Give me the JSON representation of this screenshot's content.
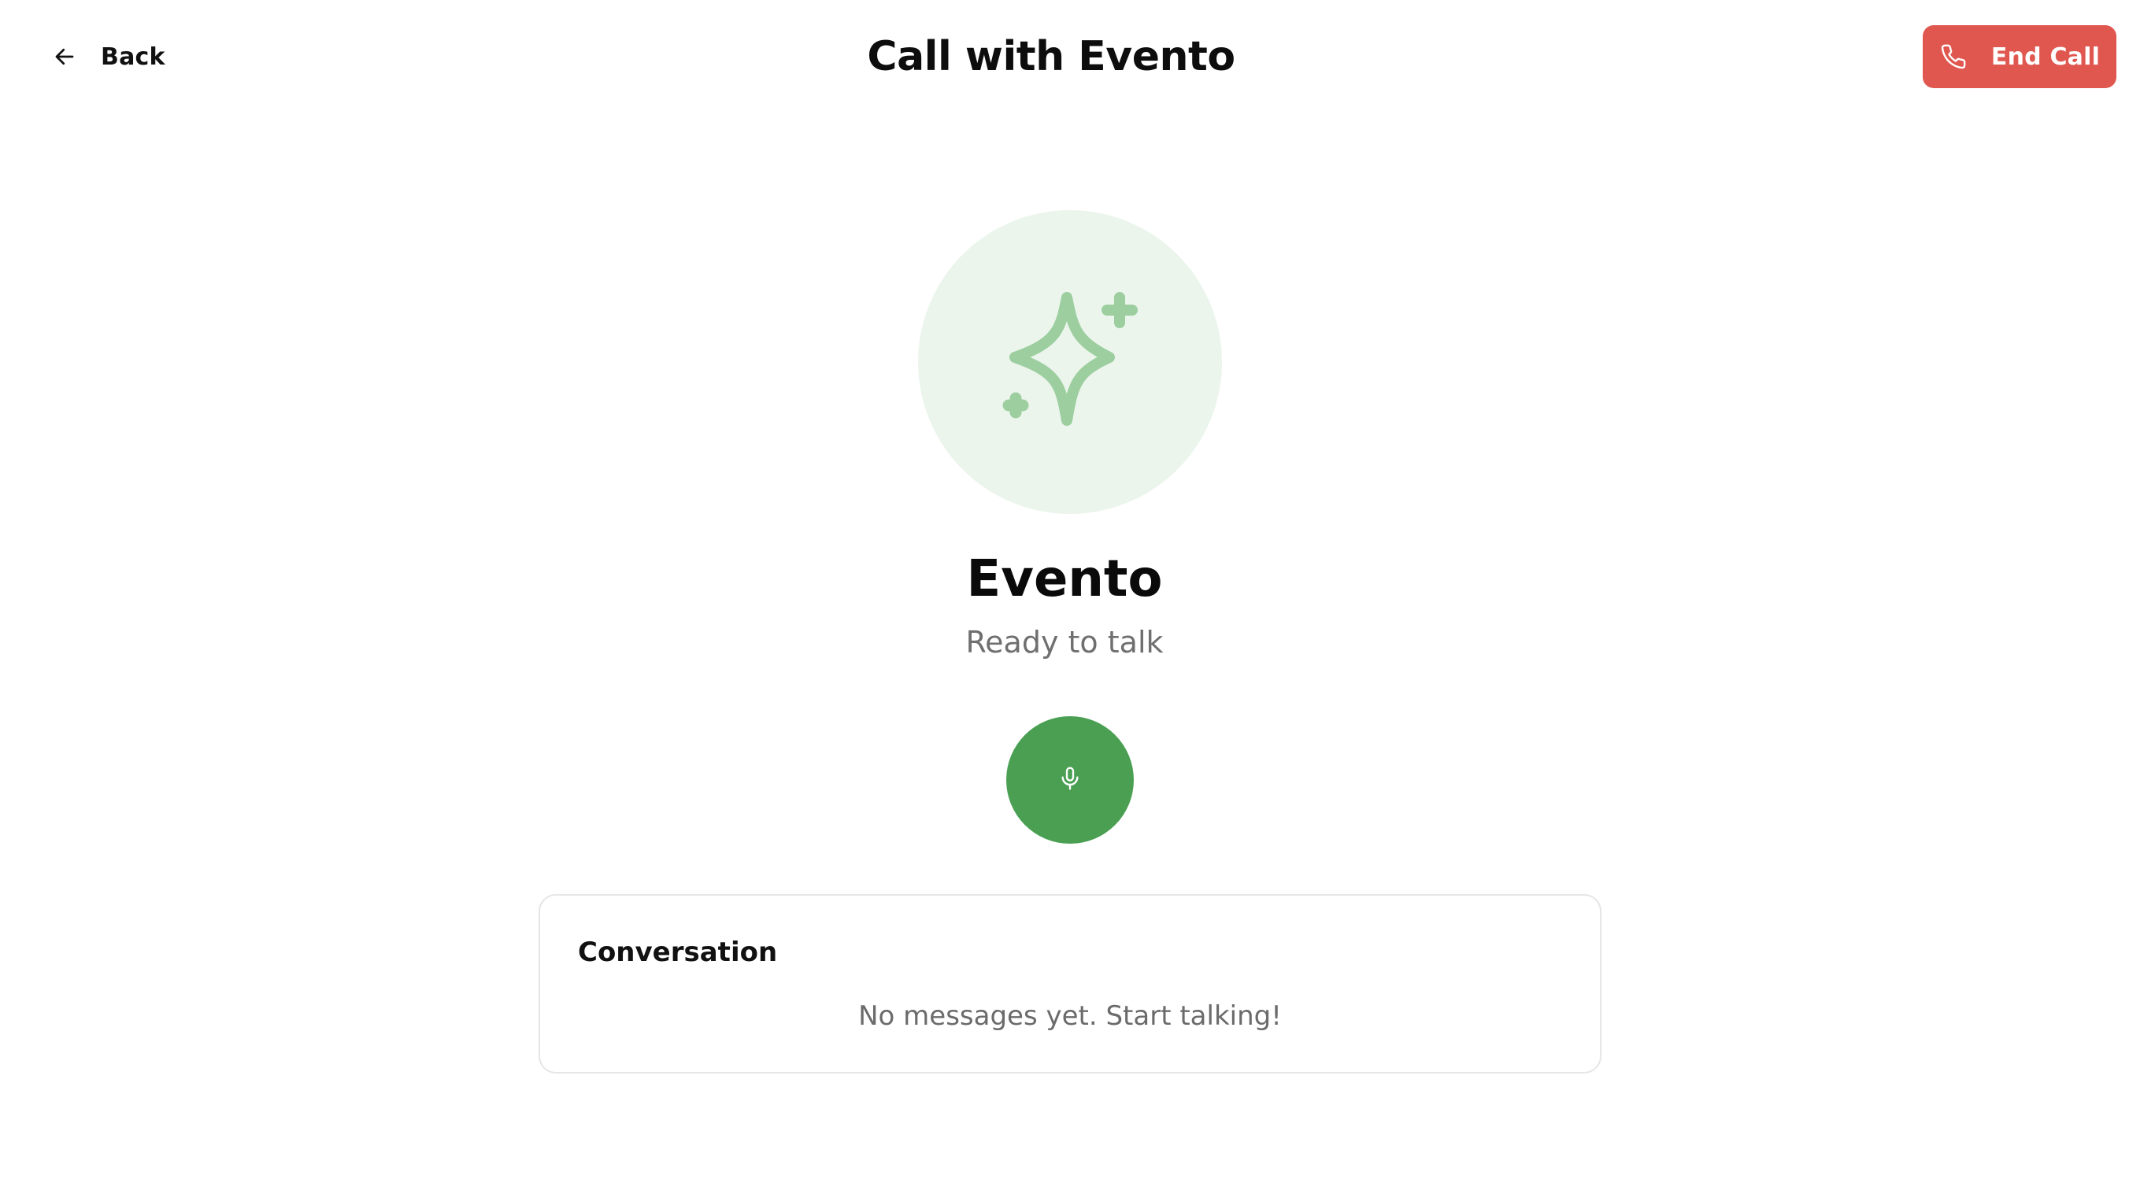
{
  "header": {
    "back_label": "Back",
    "title": "Call with Evento",
    "end_call_label": "End Call"
  },
  "agent": {
    "name": "Evento",
    "status": "Ready to talk",
    "avatar_icon": "sparkles-icon"
  },
  "controls": {
    "mic_icon": "microphone-icon"
  },
  "conversation": {
    "title": "Conversation",
    "empty_message": "No messages yet. Start talking!"
  },
  "colors": {
    "end_call": "#e05750",
    "mic": "#4a9f53",
    "avatar_bg": "#ebf5ec",
    "avatar_icon": "#9dce9f"
  }
}
